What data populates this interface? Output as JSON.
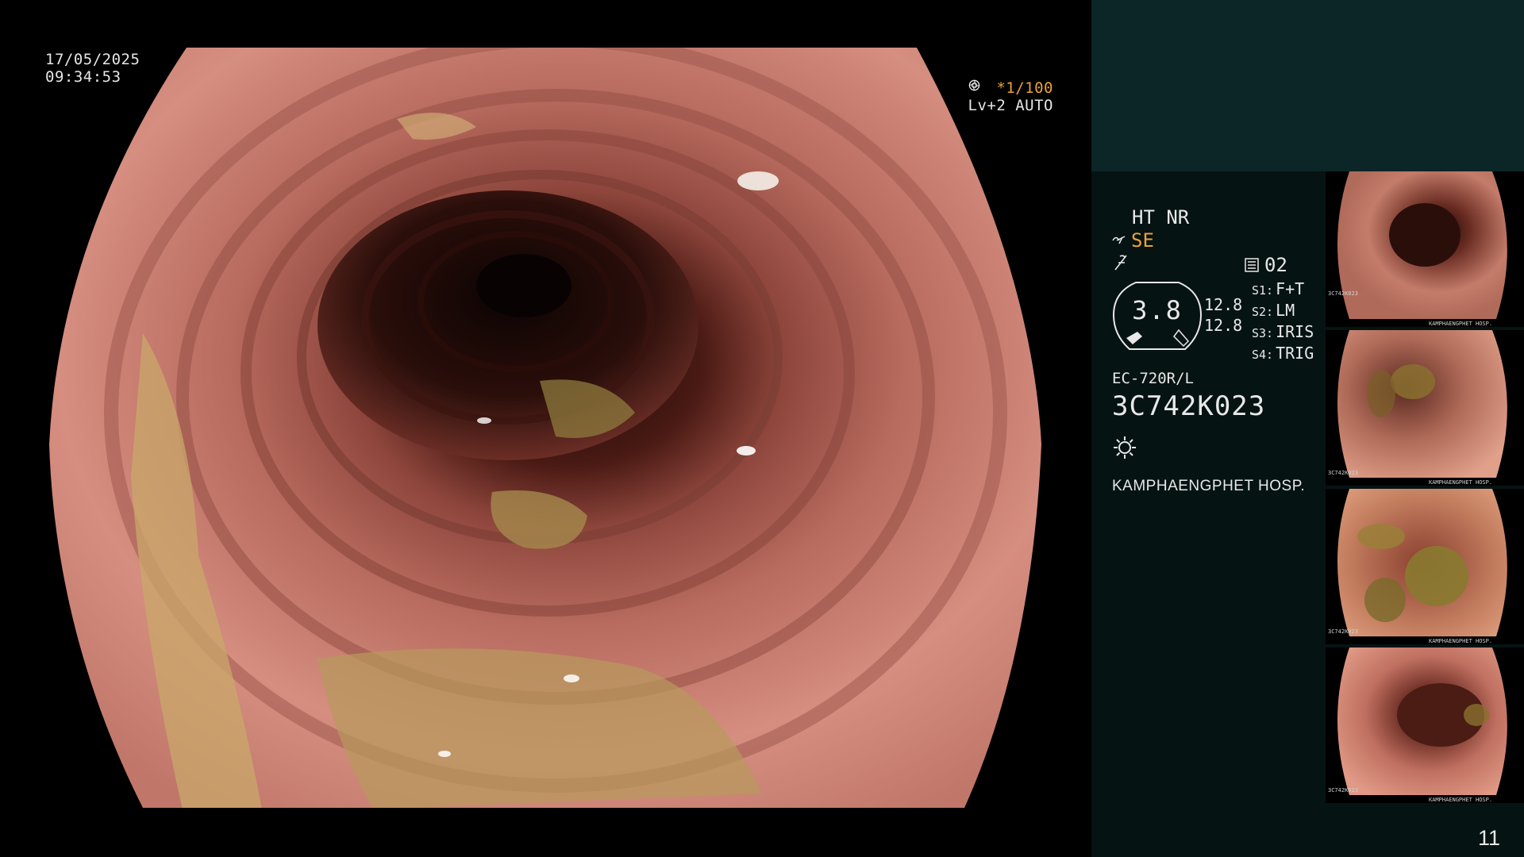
{
  "overlay": {
    "date": "17/05/2025",
    "time": "09:34:53",
    "shutter": "*1/100",
    "level": "Lv+2 AUTO",
    "icons": [
      "aperture-icon",
      "iris-icon"
    ]
  },
  "panel": {
    "ht": "HT NR",
    "se": "SE",
    "memory": "02",
    "gauge_value": "3.8",
    "value_1": "12.8",
    "value_2": "12.8",
    "switches": [
      {
        "key": "S1:",
        "value": "F+T"
      },
      {
        "key": "S2:",
        "value": "LM"
      },
      {
        "key": "S3:",
        "value": "IRIS"
      },
      {
        "key": "S4:",
        "value": "TRIG"
      }
    ],
    "scope_model": "EC-720R/L",
    "scope_serial": "3C742K023",
    "hospital": "KAMPHAENGPHET HOSP.",
    "page_number": "11"
  },
  "thumbnails": [
    {
      "serial": "3C742K023",
      "hospital": "KAMPHAENGPHET HOSP."
    },
    {
      "serial": "3C742K023",
      "hospital": "KAMPHAENGPHET HOSP."
    },
    {
      "serial": "3C742K023",
      "hospital": "KAMPHAENGPHET HOSP."
    },
    {
      "serial": "3C742K023",
      "hospital": "KAMPHAENGPHET HOSP."
    }
  ],
  "colors": {
    "accent_orange": "#e9a23a",
    "panel_top": "#0c2627",
    "panel_body": "#061313",
    "mucosa": "#c87a6c"
  }
}
